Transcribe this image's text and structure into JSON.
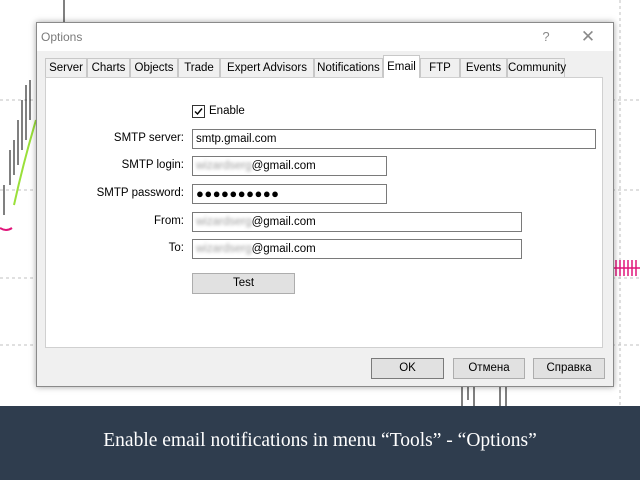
{
  "window": {
    "title": "Options",
    "help_glyph": "?",
    "close_glyph": "✕"
  },
  "tabs": [
    {
      "label": "Server"
    },
    {
      "label": "Charts"
    },
    {
      "label": "Objects"
    },
    {
      "label": "Trade"
    },
    {
      "label": "Expert Advisors"
    },
    {
      "label": "Notifications"
    },
    {
      "label": "Email",
      "active": true
    },
    {
      "label": "FTP"
    },
    {
      "label": "Events"
    },
    {
      "label": "Community"
    }
  ],
  "email": {
    "enable_label": "Enable",
    "enable_checked": true,
    "smtp_server_label": "SMTP server:",
    "smtp_server_value": "smtp.gmail.com",
    "smtp_login_label": "SMTP login:",
    "smtp_login_value_hidden": "wizardserg",
    "smtp_login_value_domain": "@gmail.com",
    "smtp_password_label": "SMTP password:",
    "smtp_password_value": "●●●●●●●●●●",
    "from_label": "From:",
    "from_value_hidden": "wizardserg",
    "from_value_domain": "@gmail.com",
    "to_label": "To:",
    "to_value_hidden": "wizardserg",
    "to_value_domain": "@gmail.com",
    "test_label": "Test"
  },
  "footer": {
    "ok_label": "OK",
    "cancel_label": "Отмена",
    "help_label": "Справка"
  },
  "caption": {
    "text": "Enable email notifications in menu “Tools” - “Options”"
  },
  "colors": {
    "banner": "#2f3d4e",
    "indicator_green": "#9ae03a",
    "indicator_magenta": "#e0157a"
  }
}
